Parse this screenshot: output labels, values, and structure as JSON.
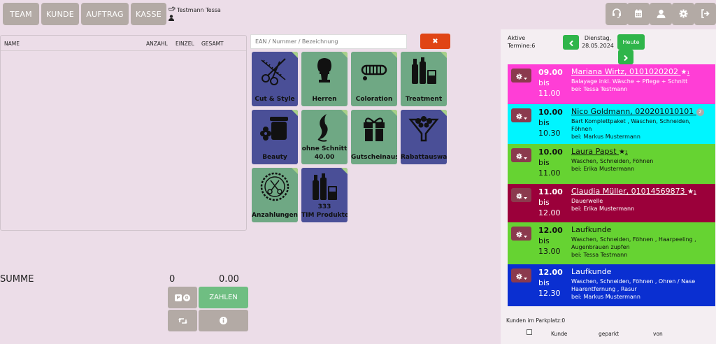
{
  "nav": {
    "team": "TEAM",
    "kunde": "KUNDE",
    "auftrag": "AUFTRAG",
    "kasse": "KASSE"
  },
  "user": {
    "name": "Testmann Tessa"
  },
  "cart": {
    "col_name": "NAME",
    "col_anzahl": "ANZAHL",
    "col_einzel": "EINZEL",
    "col_gesamt": "GESAMT",
    "summe_label": "SUMME",
    "summe_qty": "0",
    "summe_total": "0.00",
    "park_count": "0",
    "zahlen": "ZAHLEN"
  },
  "search": {
    "placeholder": "EAN / Nummer / Bezeichnung"
  },
  "tiles": [
    {
      "label": "Cut & Style",
      "icon": "scissors-comb-icon",
      "color": "blue"
    },
    {
      "label": "Herren",
      "icon": "shaving-brush-icon",
      "color": "green"
    },
    {
      "label": "Coloration",
      "icon": "hair-curlers-icon",
      "color": "green"
    },
    {
      "label": "Treatment",
      "icon": "hair-products-icon",
      "color": "green"
    },
    {
      "label": "Beauty",
      "icon": "cream-jar-icon",
      "color": "blue"
    },
    {
      "label": "ohne Schnitt",
      "price": "40.00",
      "icon": "hair-strand-icon",
      "color": "green"
    },
    {
      "label": "Gutscheinausw",
      "icon": "gift-box-icon",
      "color": "green"
    },
    {
      "label": "Rabattauswah",
      "icon": "flower-bouquet-icon",
      "color": "blue"
    },
    {
      "label": "Anzahlungen",
      "icon": "scissors-badge-icon",
      "color": "green"
    },
    {
      "label": "TIM Produkte",
      "count": "333",
      "icon": "hair-products-icon",
      "color": "blue"
    }
  ],
  "schedule": {
    "aktive_label": "Aktive",
    "termine_label": "Termine:6",
    "day": "Dienstag,",
    "date": "28.05.2024",
    "heute": "Heute",
    "bis": "bis",
    "appointments": [
      {
        "start": "09.00",
        "end": "11.00",
        "name": "Mariana Wirtz, 0101020202",
        "star": "★",
        "star_count": "1",
        "services": "Balayage inkl. Wäsche + Pflege + Schnitt",
        "staff": "bei: Tessa Testmann",
        "color": "#ff3ed6"
      },
      {
        "start": "10.00",
        "end": "10.30",
        "name": "Nico Goldmann, 020201010101",
        "badge": "2",
        "services": "Bart Komplettpaket , Waschen, Schneiden, Föhnen",
        "staff": "bei: Markus Mustermann",
        "color": "#00f5ff"
      },
      {
        "start": "10.00",
        "end": "11.00",
        "name": "Laura Papst",
        "star": "★",
        "star_count": "1",
        "services": "Waschen, Schneiden, Föhnen",
        "staff": "bei: Erika Mustermann",
        "color": "#66d332"
      },
      {
        "start": "11.00",
        "end": "12.00",
        "name": "Claudia Müller, 01014569873",
        "star": "★",
        "star_count": "1",
        "services": "Dauerwelle",
        "staff": "bei: Erika Mustermann",
        "color": "#9b003a"
      },
      {
        "start": "12.00",
        "end": "13.00",
        "name": "Laufkunde",
        "services": "Waschen, Schneiden, Föhnen , Haarpeeling , Augenbrauen zupfen",
        "staff": "bei: Tessa Testmann",
        "color": "#66d332"
      },
      {
        "start": "12.00",
        "end": "12.30",
        "name": "Laufkunde",
        "services": "Waschen, Schneiden, Föhnen , Ohren / Nase Haarentfernung , Rasur",
        "staff": "bei: Markus Mustermann",
        "color": "#0a2fd1"
      }
    ]
  },
  "parking": {
    "title": "Kunden im Parkplatz:0",
    "col_kunde": "Kunde",
    "col_geparkt": "geparkt",
    "col_von": "von"
  }
}
